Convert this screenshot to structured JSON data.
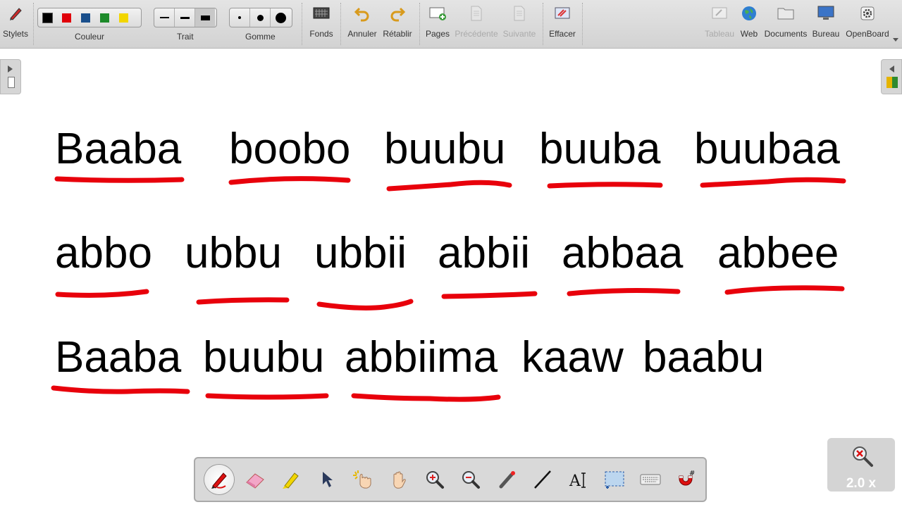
{
  "toolbar": {
    "stylets_label": "Stylets",
    "couleur_label": "Couleur",
    "trait_label": "Trait",
    "gomme_label": "Gomme",
    "fonds_label": "Fonds",
    "annuler_label": "Annuler",
    "retablir_label": "Rétablir",
    "pages_label": "Pages",
    "precedente_label": "Précédente",
    "suivante_label": "Suivante",
    "effacer_label": "Effacer",
    "tableau_label": "Tableau",
    "web_label": "Web",
    "documents_label": "Documents",
    "bureau_label": "Bureau",
    "openboard_label": "OpenBoard",
    "colors": [
      "#000000",
      "#e0000a",
      "#1a4f8c",
      "#1d8a2a",
      "#f2d600"
    ]
  },
  "board": {
    "row1": [
      "Baaba",
      "boobo",
      "buubu",
      "buuba",
      "buubaa"
    ],
    "row2": [
      "abbo",
      "ubbu",
      "ubbii",
      "abbii",
      "abbaa",
      "abbee"
    ],
    "row3": [
      "Baaba",
      "buubu",
      "abbiima",
      "kaaw",
      "baabu"
    ],
    "ink_color": "#e8000b"
  },
  "zoom": {
    "label": "2.0 x"
  }
}
